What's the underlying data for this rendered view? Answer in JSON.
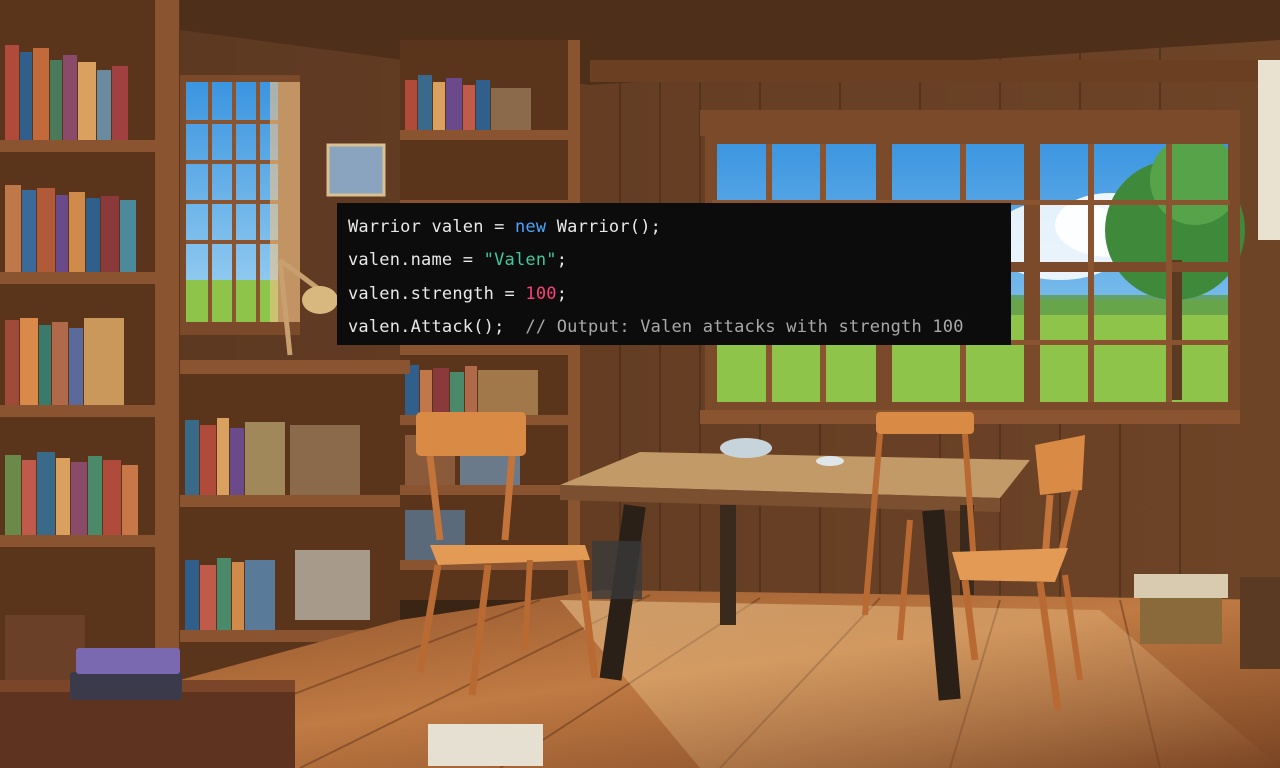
{
  "scene": {
    "name": "wooden library cabin interior",
    "colors": {
      "wood_dark": "#4a2c18",
      "wood_mid": "#7a4a2a",
      "wood_light": "#b8783e",
      "floor": "#9c5f33",
      "sky": "#4fa8e8",
      "grass": "#8fc44a",
      "chair": "#d98a45",
      "table": "#b58a5a",
      "code_bg": "#0c0c0c"
    }
  },
  "code": {
    "line1": {
      "a": "Warrior valen = ",
      "kw": "new",
      "b": " Warrior();"
    },
    "line2": {
      "a": "valen.name = ",
      "str": "\"Valen\"",
      "b": ";"
    },
    "line3": {
      "a": "valen.strength = ",
      "num": "100",
      "b": ";"
    },
    "line4": {
      "a": "valen.Attack();  ",
      "cmt": "// Output: Valen attacks with strength 100"
    }
  }
}
